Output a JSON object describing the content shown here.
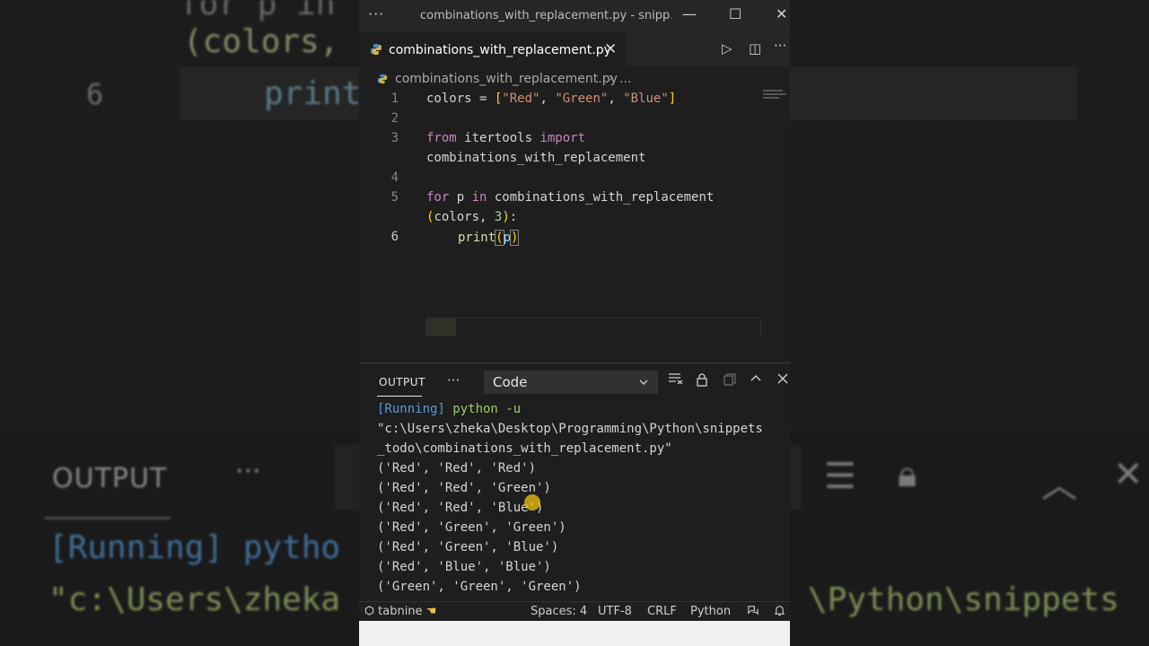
{
  "window": {
    "title": "combinations_with_replacement.py - snipp...",
    "menu_dots": "···",
    "minimize": "—",
    "maximize": "☐",
    "close": "✕"
  },
  "tab": {
    "label": "combinations_with_replacement.py",
    "close": "✕",
    "run_icon": "▷",
    "split_icon": "◫",
    "more_icon": "···"
  },
  "breadcrumb": {
    "file": "combinations_with_replacement.py",
    "separator": "›",
    "more": "..."
  },
  "code": {
    "line_numbers": [
      "1",
      "2",
      "3",
      "4",
      "5",
      "6"
    ],
    "l1": {
      "a": "colors = ",
      "b": "[",
      "s1": "\"Red\"",
      "c1": ", ",
      "s2": "\"Green\"",
      "c2": ", ",
      "s3": "\"Blue\"",
      "d": "]"
    },
    "l3a": {
      "kw1": "from",
      "mod": " itertools ",
      "kw2": "import"
    },
    "l3b": "combinations_with_replacement",
    "l5a": {
      "kw": "for",
      "p": " p ",
      "in": "in",
      "rest": " combinations_with_replacement"
    },
    "l5b": {
      "open": "(",
      "args": "colors, ",
      "num": "3",
      "close": ")",
      "colon": ":"
    },
    "l6": {
      "fn": "print",
      "open": "(",
      "arg": "p",
      "close": ")"
    }
  },
  "panel": {
    "title": "OUTPUT",
    "dots": "···",
    "select_value": "Code",
    "select_chevron": "⌄",
    "icons": [
      "clear-output-icon",
      "lock-icon",
      "copy-icon",
      "chevron-up-icon",
      "close-icon"
    ]
  },
  "terminal": {
    "running": "[Running]",
    "cmd": " python -u",
    "path1": "\"c:\\Users\\zheka\\Desktop\\Programming\\Python\\snippets",
    "path2": "_todo\\combinations_with_replacement.py\"",
    "rows": [
      "('Red', 'Red', 'Red')",
      "('Red', 'Red', 'Green')",
      "('Red', 'Red', 'Blue')",
      "('Red', 'Green', 'Green')",
      "('Red', 'Green', 'Blue')",
      "('Red', 'Blue', 'Blue')",
      "('Green', 'Green', 'Green')"
    ]
  },
  "statusbar": {
    "tabnine": "tabnine",
    "spaces": "Spaces: 4",
    "encoding": "UTF-8",
    "eol": "CRLF",
    "language": "Python"
  },
  "background": {
    "code_top": "for p in",
    "code_colors": "(colors,",
    "line6": "6",
    "code_print": "print",
    "output": "OUTPUT",
    "dots": "···",
    "running": "[Running] pytho",
    "path_left": "\"c:\\Users\\zheka",
    "path_right": "\\Python\\snippets"
  },
  "colors": {
    "keyword": "#c586c0",
    "string": "#ce9178",
    "bracket": "#ffd700",
    "terminal_green": "#9ccc65",
    "terminal_blue": "#569cd6"
  }
}
